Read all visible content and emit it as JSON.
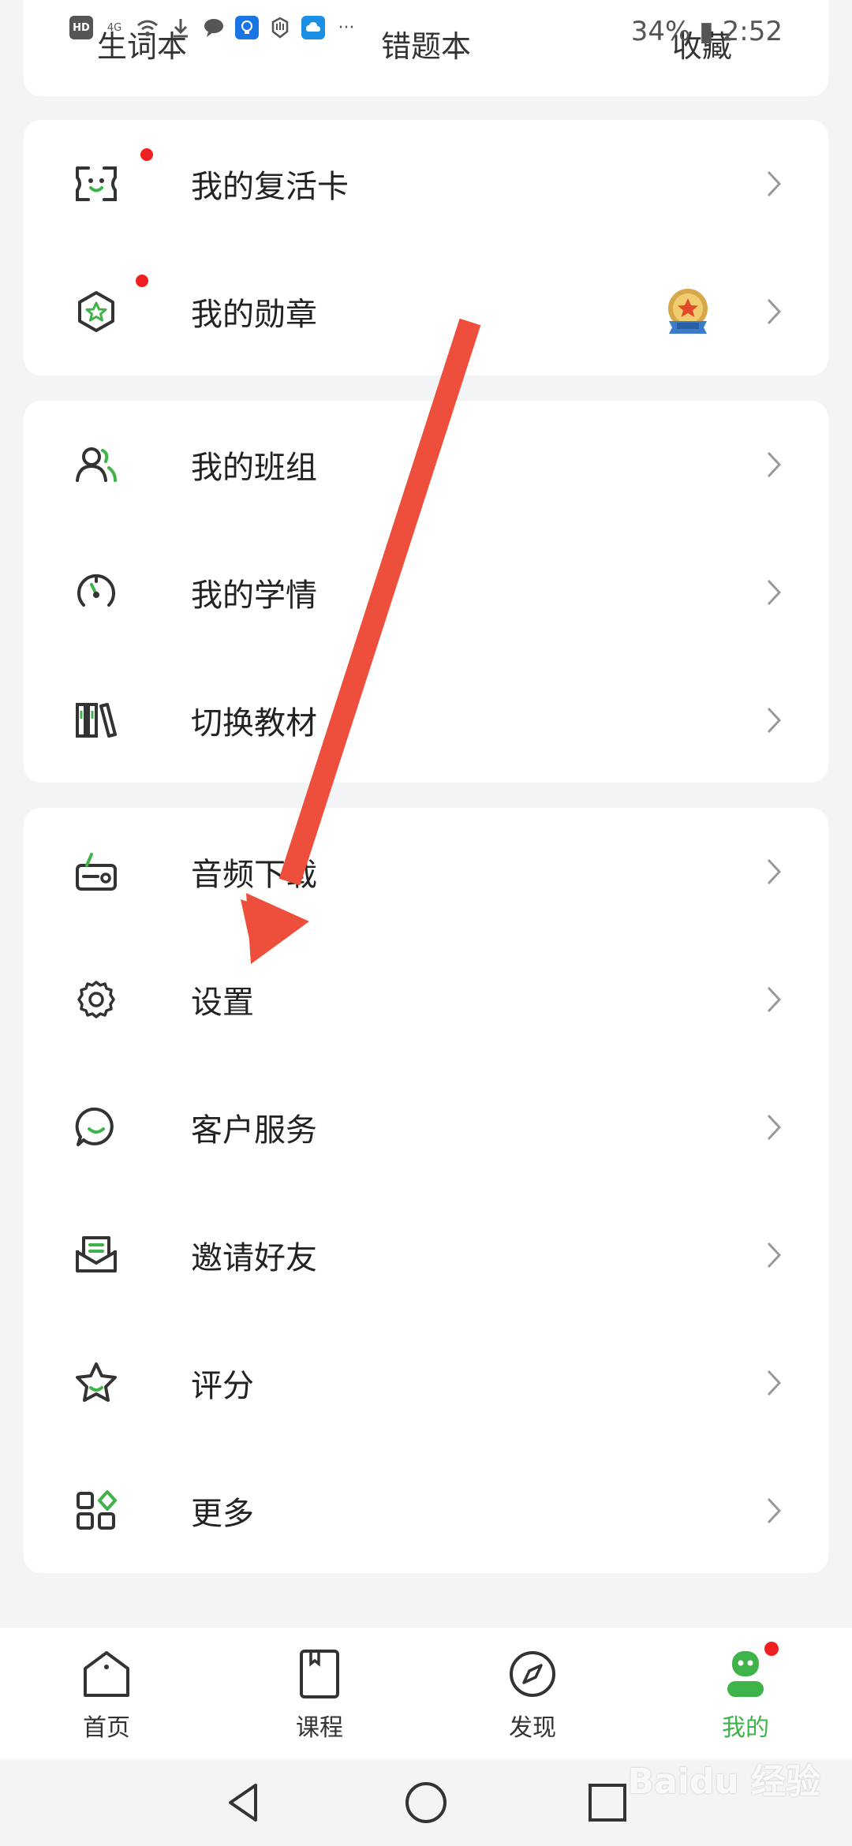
{
  "status_bar": {
    "battery_time": "34% ▮ 2:52",
    "indicators": [
      "hd-icon",
      "signal-icon",
      "wifi-icon",
      "download-icon",
      "message-icon",
      "app-icon",
      "hand-icon",
      "cloud-icon",
      "more-icon"
    ]
  },
  "shortcuts": [
    {
      "label": "生词本"
    },
    {
      "label": "错题本"
    },
    {
      "label": "收藏"
    }
  ],
  "menu_groups": [
    [
      {
        "label": "我的复活卡",
        "icon": "revive-card-icon",
        "dot": true
      },
      {
        "label": "我的勋章",
        "icon": "medal-icon",
        "dot": true,
        "badge": "medal-badge"
      }
    ],
    [
      {
        "label": "我的班组",
        "icon": "group-icon"
      },
      {
        "label": "我的学情",
        "icon": "gauge-icon"
      },
      {
        "label": "切换教材",
        "icon": "books-icon"
      }
    ],
    [
      {
        "label": "音频下载",
        "icon": "radio-icon"
      },
      {
        "label": "设置",
        "icon": "gear-icon"
      },
      {
        "label": "客户服务",
        "icon": "chat-icon"
      },
      {
        "label": "邀请好友",
        "icon": "mail-icon"
      },
      {
        "label": "评分",
        "icon": "star-icon"
      },
      {
        "label": "更多",
        "icon": "grid-icon"
      }
    ]
  ],
  "bottom_nav": [
    {
      "label": "首页",
      "icon": "home-icon"
    },
    {
      "label": "课程",
      "icon": "book-icon"
    },
    {
      "label": "发现",
      "icon": "compass-icon"
    },
    {
      "label": "我的",
      "icon": "profile-icon",
      "active": true
    }
  ],
  "colors": {
    "accent": "#3eb34a",
    "dot": "#f02020",
    "arrow": "#ee4f3c"
  },
  "watermark": "Baidu 经验"
}
